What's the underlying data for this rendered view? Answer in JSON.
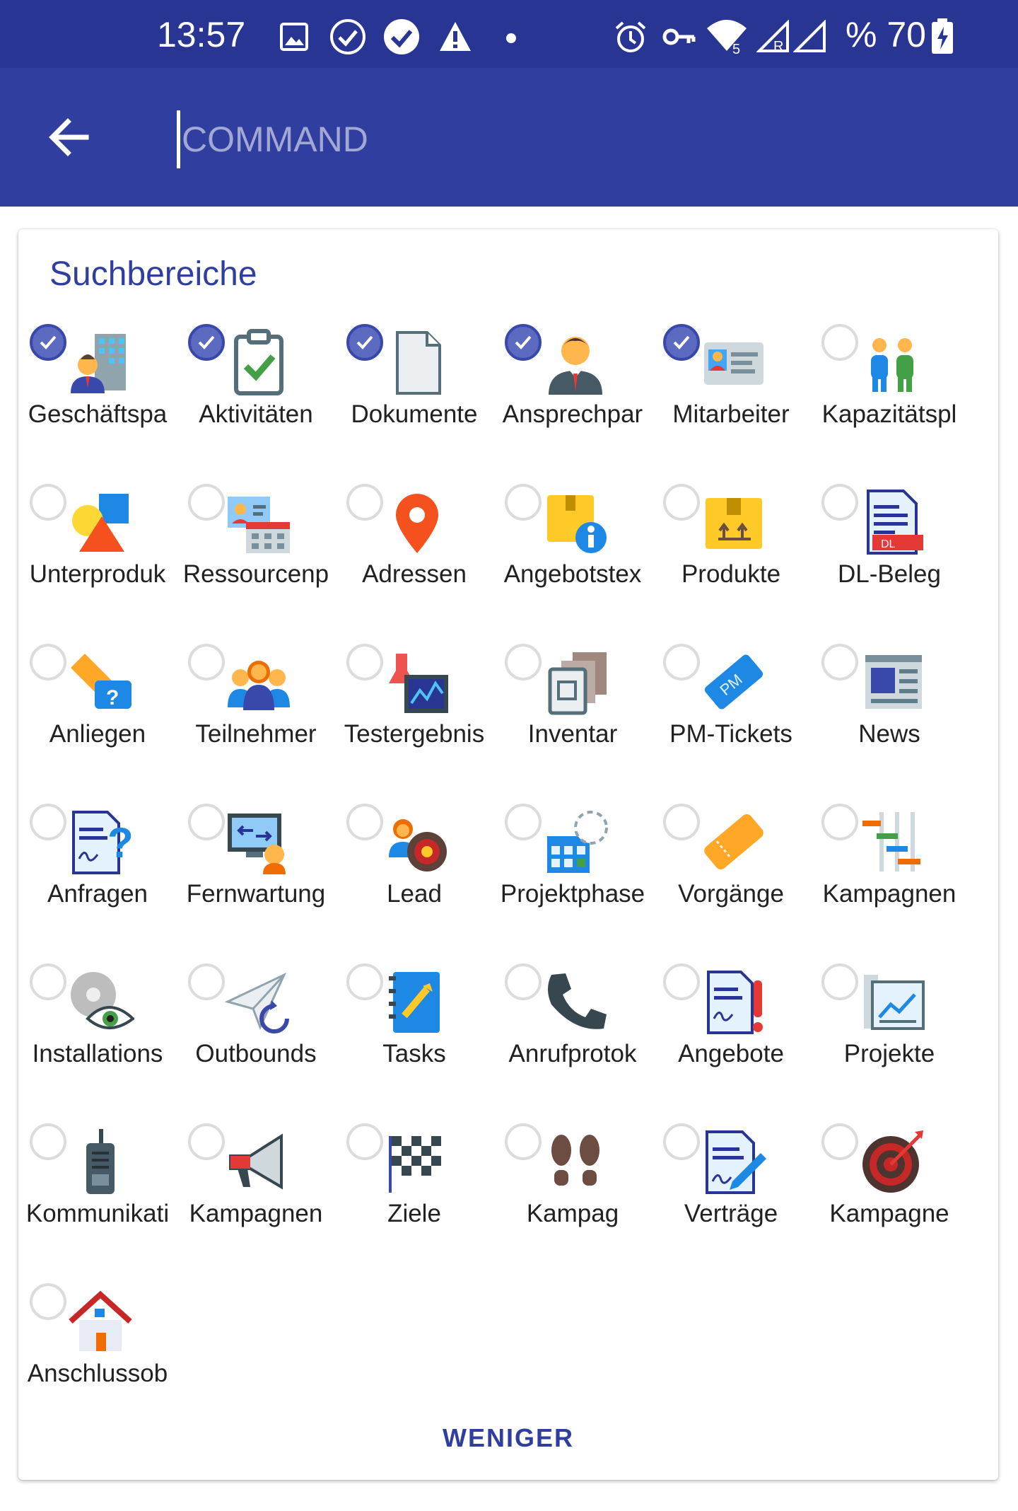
{
  "status_bar": {
    "time": "13:57",
    "battery_text": "% 70",
    "left_icons": [
      "image-icon",
      "check-circle-outline-icon",
      "check-circle-icon",
      "warning-icon",
      "dot-icon"
    ],
    "right_icons": [
      "alarm-icon",
      "vpn-key-icon",
      "wifi-icon",
      "signal-r-icon",
      "signal-icon",
      "battery-charging-icon"
    ]
  },
  "app_bar": {
    "back_icon": "arrow-back-icon",
    "search_placeholder": "COMMAND",
    "background_color": "#303f9f",
    "status_color": "#283593"
  },
  "card": {
    "title": "Suchbereiche",
    "less_label": "WENIGER",
    "accent_color": "#3f51b5",
    "items": [
      {
        "label": "Geschäftspa",
        "icon": "business-partner-icon",
        "checked": true
      },
      {
        "label": "Aktivitäten",
        "icon": "clipboard-check-icon",
        "checked": true
      },
      {
        "label": "Dokumente",
        "icon": "document-icon",
        "checked": true
      },
      {
        "label": "Ansprechpar",
        "icon": "contact-person-icon",
        "checked": true
      },
      {
        "label": "Mitarbeiter",
        "icon": "employee-card-icon",
        "checked": true
      },
      {
        "label": "Kapazitätspl",
        "icon": "capacity-people-icon",
        "checked": false
      },
      {
        "label": "Unterproduk",
        "icon": "shapes-icon",
        "checked": false
      },
      {
        "label": "Ressourcenp",
        "icon": "resource-planning-icon",
        "checked": false
      },
      {
        "label": "Adressen",
        "icon": "map-pin-icon",
        "checked": false
      },
      {
        "label": "Angebotstex",
        "icon": "package-info-icon",
        "checked": false
      },
      {
        "label": "Produkte",
        "icon": "package-icon",
        "checked": false
      },
      {
        "label": "DL-Beleg",
        "icon": "service-receipt-icon",
        "checked": false
      },
      {
        "label": "Anliegen",
        "icon": "ticket-question-icon",
        "checked": false
      },
      {
        "label": "Teilnehmer",
        "icon": "participants-icon",
        "checked": false
      },
      {
        "label": "Testergebnis",
        "icon": "test-result-icon",
        "checked": false
      },
      {
        "label": "Inventar",
        "icon": "inventory-icon",
        "checked": false
      },
      {
        "label": "PM-Tickets",
        "icon": "pm-ticket-icon",
        "checked": false
      },
      {
        "label": "News",
        "icon": "newspaper-icon",
        "checked": false
      },
      {
        "label": "Anfragen",
        "icon": "inquiry-document-icon",
        "checked": false
      },
      {
        "label": "Fernwartung",
        "icon": "remote-maintenance-icon",
        "checked": false
      },
      {
        "label": "Lead",
        "icon": "lead-target-icon",
        "checked": false
      },
      {
        "label": "Projektphase",
        "icon": "project-phase-icon",
        "checked": false
      },
      {
        "label": "Vorgänge",
        "icon": "process-ticket-icon",
        "checked": false
      },
      {
        "label": "Kampagnen",
        "icon": "gantt-chart-icon",
        "checked": false
      },
      {
        "label": "Installations",
        "icon": "disc-eye-icon",
        "checked": false
      },
      {
        "label": "Outbounds",
        "icon": "paper-plane-icon",
        "checked": false
      },
      {
        "label": "Tasks",
        "icon": "task-book-icon",
        "checked": false
      },
      {
        "label": "Anrufprotok",
        "icon": "phone-icon",
        "checked": false
      },
      {
        "label": "Angebote",
        "icon": "offer-document-icon",
        "checked": false
      },
      {
        "label": "Projekte",
        "icon": "project-chart-icon",
        "checked": false
      },
      {
        "label": "Kommunikati",
        "icon": "walkie-talkie-icon",
        "checked": false
      },
      {
        "label": "Kampagnen",
        "icon": "megaphone-icon",
        "checked": false
      },
      {
        "label": "Ziele",
        "icon": "checkered-flag-icon",
        "checked": false
      },
      {
        "label": "Kampag",
        "icon": "footprints-icon",
        "checked": false
      },
      {
        "label": "Verträge",
        "icon": "contract-icon",
        "checked": false
      },
      {
        "label": "Kampagne",
        "icon": "dartboard-icon",
        "checked": false
      },
      {
        "label": "Anschlussob",
        "icon": "house-icon",
        "checked": false
      }
    ]
  }
}
